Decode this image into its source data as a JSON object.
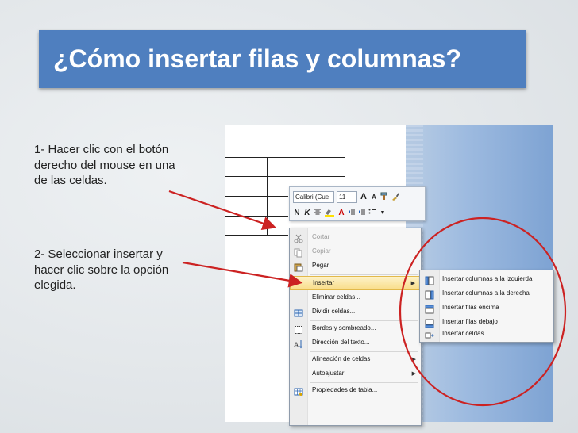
{
  "slide": {
    "title": "¿Cómo insertar filas y columnas?",
    "step1": "1- Hacer clic con el botón derecho del mouse en una de las celdas.",
    "step2": "2- Seleccionar insertar y hacer clic sobre la opción elegida.",
    "colors": {
      "title_bg": "#4f7fbf",
      "arrow": "#cc2222",
      "circle": "#cc2222"
    }
  },
  "mini_toolbar": {
    "font_name": "Calibri (Cue",
    "font_size": "11",
    "grow_font": "A",
    "shrink_font": "A",
    "bold": "N",
    "italic": "K",
    "font_color": "A"
  },
  "context_menu": {
    "items": [
      {
        "label": "Cortar",
        "icon": "scissors-icon",
        "disabled": true
      },
      {
        "label": "Copiar",
        "icon": "copy-icon",
        "disabled": true
      },
      {
        "label": "Pegar",
        "icon": "paste-icon",
        "disabled": false
      },
      {
        "label": "Insertar",
        "icon": "",
        "disabled": false,
        "submenu": true,
        "highlighted": true
      },
      {
        "label": "Eliminar celdas...",
        "icon": "",
        "disabled": false
      },
      {
        "label": "Dividir celdas...",
        "icon": "split-cells-icon",
        "disabled": false
      },
      {
        "label": "Bordes y sombreado...",
        "icon": "borders-icon",
        "disabled": false
      },
      {
        "label": "Dirección del texto...",
        "icon": "text-direction-icon",
        "disabled": false
      },
      {
        "label": "Alineación de celdas",
        "icon": "",
        "disabled": false,
        "submenu": true
      },
      {
        "label": "Autoajustar",
        "icon": "",
        "disabled": false,
        "submenu": true
      },
      {
        "label": "Propiedades de tabla...",
        "icon": "table-properties-icon",
        "disabled": false
      }
    ]
  },
  "insert_submenu": {
    "items": [
      {
        "label": "Insertar columnas a la izquierda",
        "icon": "insert-column-left-icon"
      },
      {
        "label": "Insertar columnas a la derecha",
        "icon": "insert-column-right-icon"
      },
      {
        "label": "Insertar filas encima",
        "icon": "insert-row-above-icon"
      },
      {
        "label": "Insertar filas debajo",
        "icon": "insert-row-below-icon"
      },
      {
        "label": "Insertar celdas...",
        "icon": "insert-cells-icon"
      }
    ]
  }
}
